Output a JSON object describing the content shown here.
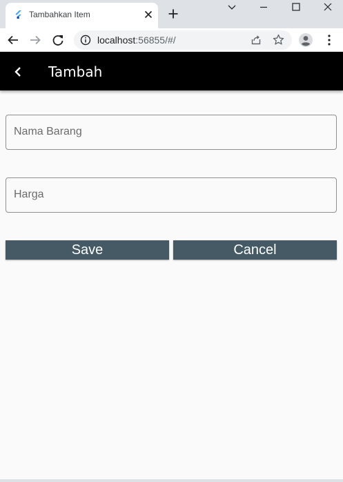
{
  "browser": {
    "tab_title": "Tambahkan Item",
    "url_host": "localhost",
    "url_rest": ":56855/#/"
  },
  "icons": {
    "favicon": "flutter-logo-icon",
    "tab_close": "close-icon",
    "new_tab": "plus-icon",
    "minimize": "minimize-icon",
    "maximize": "maximize-icon",
    "close_window": "close-icon",
    "tab_search": "chevron-down-icon",
    "back": "arrow-left-icon",
    "forward": "arrow-right-icon",
    "reload": "reload-icon",
    "site_info": "info-icon",
    "share": "share-icon",
    "bookmark": "star-icon",
    "profile": "avatar-icon",
    "menu": "more-vertical-icon",
    "app_back": "chevron-left-icon"
  },
  "app": {
    "title": "Tambah",
    "appbar_color": "#000000",
    "button_color": "#455a64",
    "fields": {
      "name_placeholder": "Nama Barang",
      "price_placeholder": "Harga"
    },
    "buttons": {
      "save": "Save",
      "cancel": "Cancel"
    }
  }
}
